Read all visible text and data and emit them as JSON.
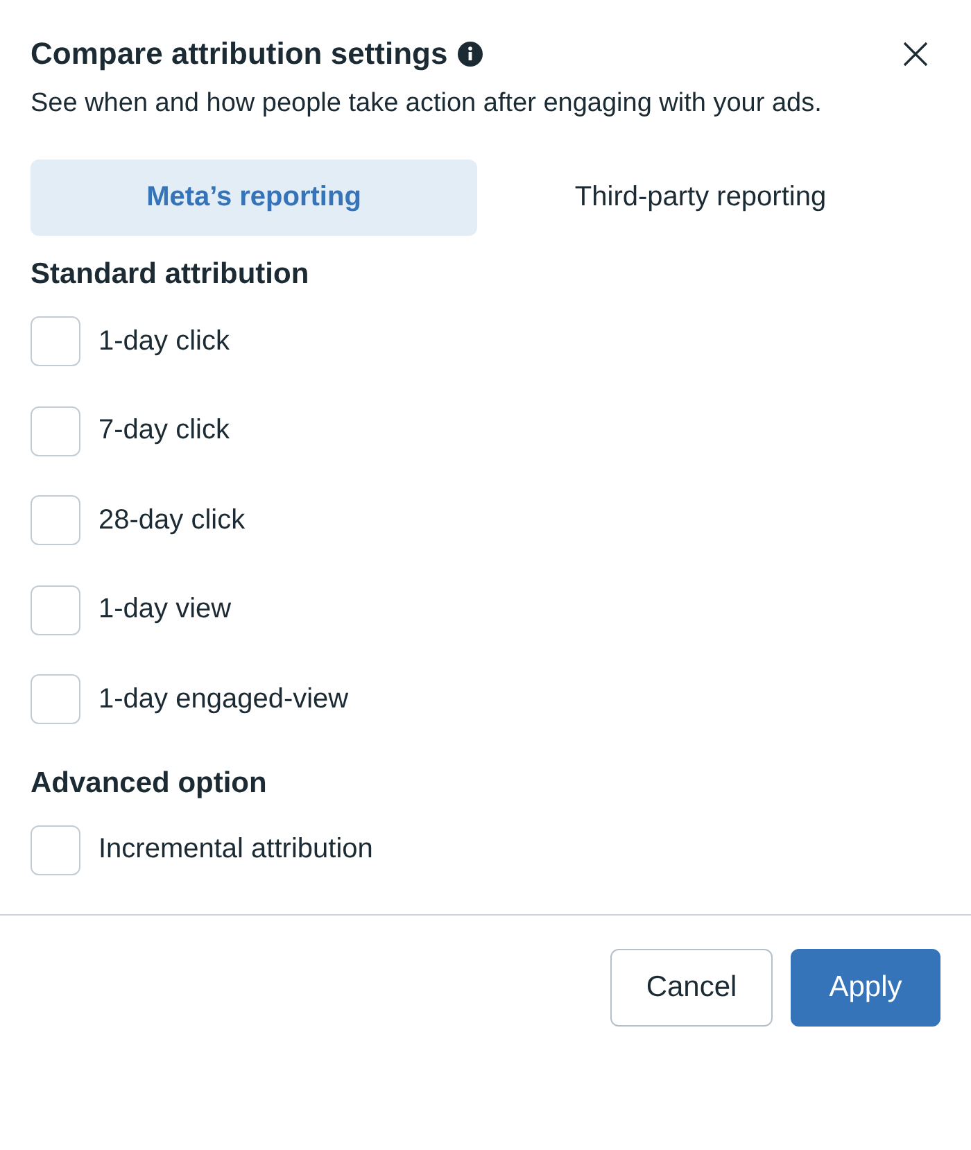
{
  "dialog": {
    "title": "Compare attribution settings",
    "description": "See when and how people take action after engaging with your ads."
  },
  "tabs": [
    {
      "label": "Meta’s reporting",
      "selected": true
    },
    {
      "label": "Third-party reporting",
      "selected": false
    }
  ],
  "sections": [
    {
      "heading": "Standard attribution",
      "options": [
        {
          "label": "1-day click",
          "checked": false
        },
        {
          "label": "7-day click",
          "checked": false
        },
        {
          "label": "28-day click",
          "checked": false
        },
        {
          "label": "1-day view",
          "checked": false
        },
        {
          "label": "1-day engaged-view",
          "checked": false
        }
      ]
    },
    {
      "heading": "Advanced option",
      "options": [
        {
          "label": "Incremental attribution",
          "checked": false
        }
      ]
    }
  ],
  "buttons": [
    {
      "label": "Cancel",
      "kind": "secondary"
    },
    {
      "label": "Apply",
      "kind": "primary"
    }
  ]
}
